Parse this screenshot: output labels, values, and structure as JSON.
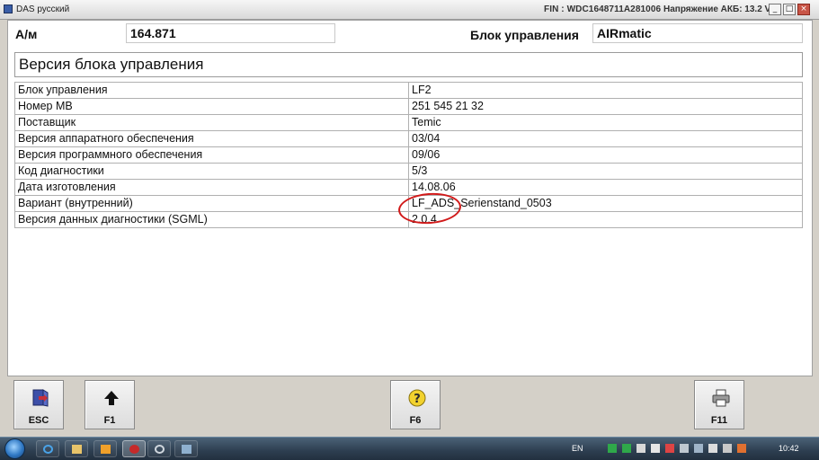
{
  "window": {
    "title": "DAS русский",
    "fin": "FIN : WDC1648711A281006",
    "battery": "Напряжение АКБ: 13.2 V",
    "controls": [
      "_",
      "□",
      "×"
    ]
  },
  "header": {
    "am_label": "А/м",
    "am_value": "164.871",
    "ecu_label": "Блок управления",
    "ecu_value": "AIRmatic"
  },
  "section_title": "Версия блока управления",
  "rows": [
    {
      "key": "Блок управления",
      "value": "LF2"
    },
    {
      "key": "Номер MB",
      "value": "251 545 21 32"
    },
    {
      "key": "Поставщик",
      "value": "Temic"
    },
    {
      "key": "Версия аппаратного обеспечения",
      "value": "03/04"
    },
    {
      "key": "Версия программного обеспечения",
      "value": "09/06"
    },
    {
      "key": "Код диагностики",
      "value": "5/3"
    },
    {
      "key": "Дата изготовления",
      "value": "14.08.06"
    },
    {
      "key": "Вариант (внутренний)",
      "value": "LF_ADS_Serienstand_0503"
    },
    {
      "key": "Версия данных диагностики (SGML)",
      "value": "2.0.4"
    }
  ],
  "fkeys": {
    "esc": {
      "label": "ESC",
      "icon": "exit-door-icon"
    },
    "f1": {
      "label": "F1",
      "icon": "arrow-up-icon"
    },
    "f6": {
      "label": "F6",
      "icon": "help-icon"
    },
    "f11": {
      "label": "F11",
      "icon": "printer-icon"
    }
  },
  "taskbar": {
    "language": "EN",
    "clock": "10:42"
  },
  "colors": {
    "highlight_oval": "#d11a1a",
    "chrome": "#d4d0c8",
    "taskbar": "#2d3e50"
  }
}
